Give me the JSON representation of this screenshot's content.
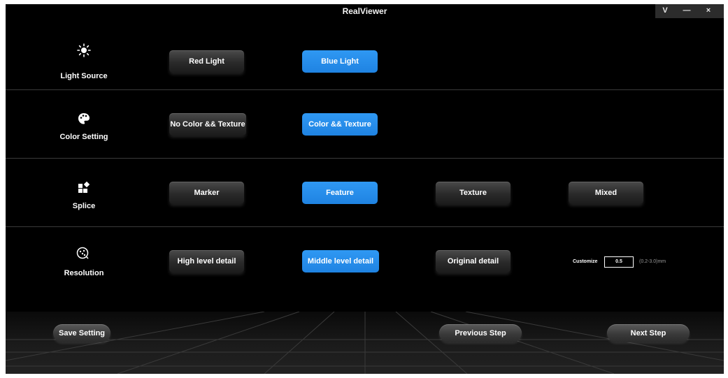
{
  "window": {
    "title": "RealViewer",
    "controls": [
      "V",
      "—",
      "×"
    ]
  },
  "rows": [
    {
      "label": "Light Source",
      "icon": "sun-icon",
      "options": [
        "Red Light",
        "Blue Light"
      ],
      "selected": "Blue Light"
    },
    {
      "label": "Color Setting",
      "icon": "palette-icon",
      "options": [
        "No Color && Texture",
        "Color && Texture"
      ],
      "selected": "Color && Texture"
    },
    {
      "label": "Splice",
      "icon": "puzzle-icon",
      "options": [
        "Marker",
        "Feature",
        "Texture",
        "Mixed"
      ],
      "selected": "Feature"
    },
    {
      "label": "Resolution",
      "icon": "resolution-icon",
      "options": [
        "High level detail",
        "Middle level detail",
        "Original detail"
      ],
      "selected": "Middle level detail",
      "customize": {
        "label": "Customize",
        "value": "0.5",
        "range": "(0.2-3.0)mm"
      }
    }
  ],
  "footer": {
    "save": "Save Setting",
    "previous": "Previous Step",
    "next": "Next Step"
  },
  "colors": {
    "accent": "#2b8ef0",
    "background": "#000000",
    "button_dark": "#2a2a2a"
  }
}
